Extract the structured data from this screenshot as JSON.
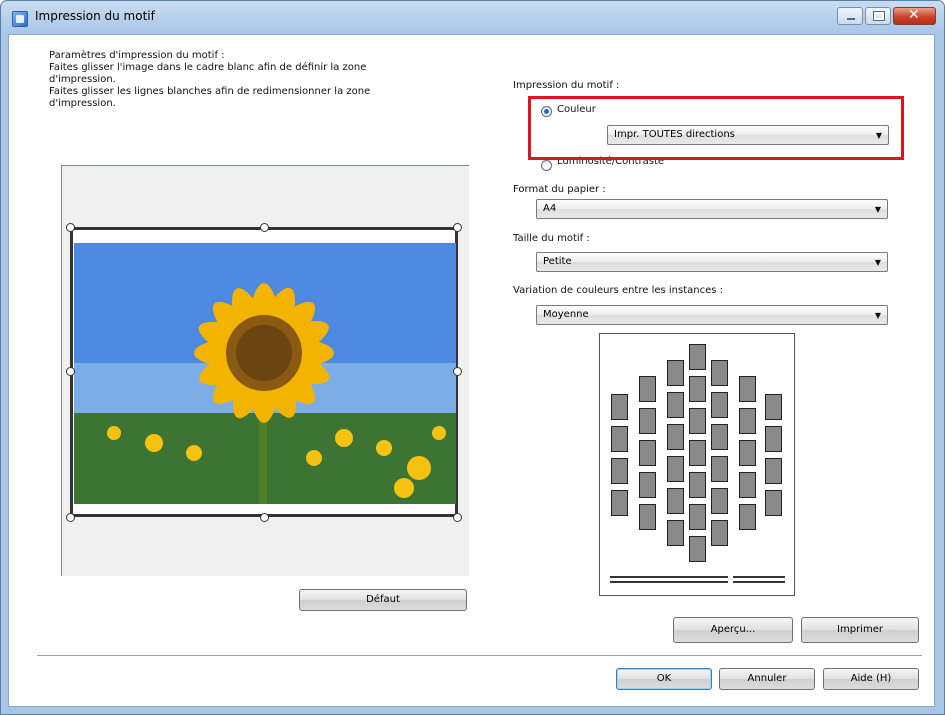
{
  "window": {
    "title": "Impression du motif"
  },
  "instructions": {
    "lines": [
      "Paramètres d'impression du motif :",
      "Faites glisser l'image dans le cadre blanc afin de définir la zone",
      "d'impression.",
      "Faites glisser les lignes blanches afin de redimensionner la zone",
      "d'impression."
    ]
  },
  "left": {
    "default_button": "Défaut"
  },
  "right": {
    "impression_label": "Impression du motif :",
    "couleur_label": "Couleur",
    "couleur_select": "Impr. TOUTES directions",
    "luminosite_label": "Luminosité/Contraste",
    "paper_label": "Format du papier :",
    "paper_value": "A4",
    "size_label": "Taille du motif :",
    "size_value": "Petite",
    "variation_label": "Variation de couleurs entre les instances :",
    "variation_value": "Moyenne"
  },
  "buttons": {
    "preview": "Aperçu...",
    "print": "Imprimer",
    "ok": "OK",
    "cancel": "Annuler",
    "help": "Aide (H)"
  },
  "icons": {
    "app": "pattern-print-app-icon",
    "minimize": "minimize-icon",
    "maximize": "maximize-icon",
    "close": "close-icon"
  }
}
